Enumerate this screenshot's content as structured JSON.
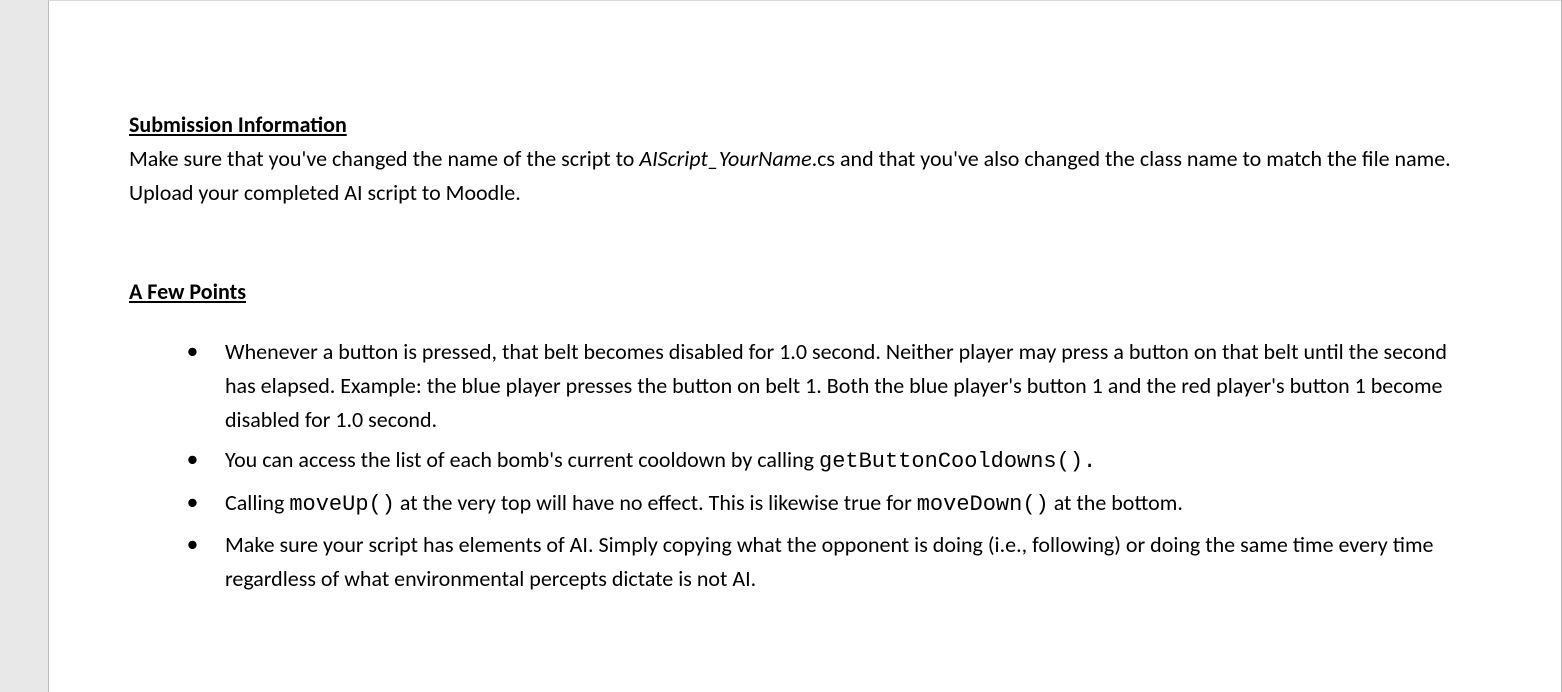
{
  "submission": {
    "heading": "Submission Information",
    "para_part1": "Make sure that you've changed the name of the script to ",
    "filename_italic": "AIScript_YourName",
    "filename_ext": ".cs",
    "para_part2": " and that you've also changed the class name to match the file name. Upload your completed AI script to Moodle."
  },
  "points": {
    "heading": "A Few Points",
    "items": [
      {
        "text": "Whenever a button is pressed, that belt becomes disabled for 1.0 second. Neither player may press a button on that belt until the second has elapsed.  Example:  the blue player presses the button on belt 1.  Both the blue player's button 1 and the red player's button 1 become disabled for 1.0 second."
      },
      {
        "pre": "You can access the list of each bomb's current cooldown by calling ",
        "code": "getButtonCooldowns().",
        "post": ""
      },
      {
        "pre": "Calling ",
        "code1": "moveUp()",
        "mid": " at the very top will have no effect.  This is likewise true for ",
        "code2": "moveDown()",
        "post": " at the bottom."
      },
      {
        "text": "Make sure your script has elements of AI. Simply copying what the opponent is doing (i.e., following) or doing the same time every time regardless of what environmental percepts dictate is not AI."
      }
    ]
  }
}
